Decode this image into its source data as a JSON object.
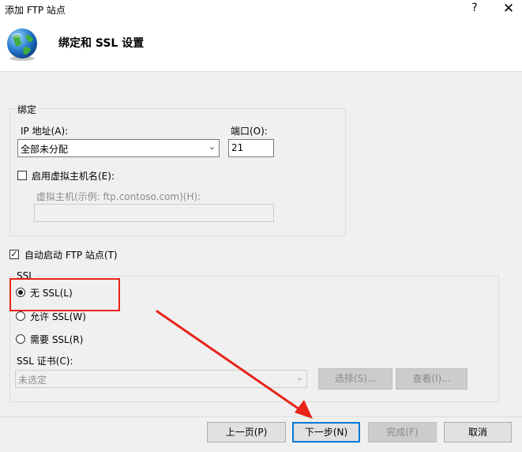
{
  "window": {
    "title": "添加 FTP 站点",
    "help_label": "?",
    "close_label": "✕"
  },
  "header": {
    "title": "绑定和 SSL 设置",
    "icon": "globe-icon"
  },
  "binding": {
    "group_label": "绑定",
    "ip_label": "IP 地址(A):",
    "ip_value": "全部未分配",
    "port_label": "端口(O):",
    "port_value": "21",
    "virtual_host_checkbox_label": "启用虚拟主机名(E):",
    "virtual_host_checked": false,
    "virtual_host_field_label": "虚拟主机(示例: ftp.contoso.com)(H):",
    "virtual_host_value": ""
  },
  "auto_start": {
    "label": "自动启动 FTP 站点(T)",
    "checked": true
  },
  "ssl": {
    "group_label": "SSL",
    "options": [
      {
        "label": "无 SSL(L)",
        "selected": true
      },
      {
        "label": "允许 SSL(W)",
        "selected": false
      },
      {
        "label": "需要 SSL(R)",
        "selected": false
      }
    ],
    "cert_label": "SSL 证书(C):",
    "cert_value": "未选定",
    "select_button": "选择(S)...",
    "view_button": "查看(I)..."
  },
  "footer": {
    "prev_button": "上一页(P)",
    "next_button": "下一步(N)",
    "finish_button": "完成(F)",
    "cancel_button": "取消"
  },
  "annotation": {
    "highlight_color": "#e8231a"
  }
}
